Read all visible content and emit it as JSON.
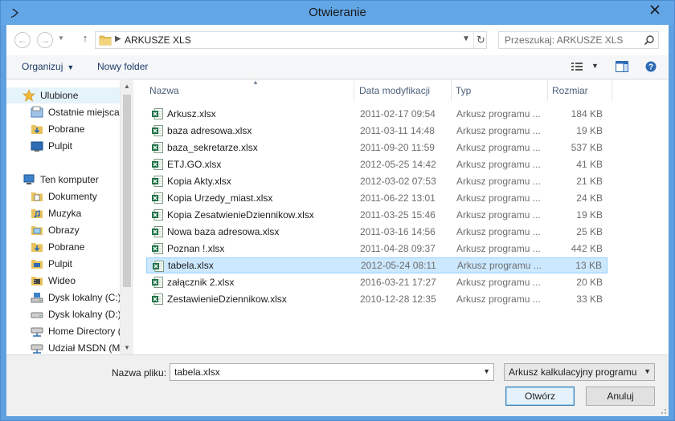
{
  "window": {
    "title": "Otwieranie",
    "accent": "#62a6e6"
  },
  "address": {
    "path": "ARKUSZE XLS",
    "search_placeholder": "Przeszukaj: ARKUSZE XLS"
  },
  "toolbar": {
    "organize_label": "Organizuj",
    "new_folder_label": "Nowy folder"
  },
  "nav": {
    "favorites": {
      "label": "Ulubione",
      "items": [
        "Ostatnie miejsca",
        "Pobrane",
        "Pulpit"
      ]
    },
    "computer": {
      "label": "Ten komputer",
      "items": [
        "Dokumenty",
        "Muzyka",
        "Obrazy",
        "Pobrane",
        "Pulpit",
        "Wideo",
        "Dysk lokalny (C:)",
        "Dysk lokalny (D:)",
        "Home Directory (",
        "Udział MSDN (M:"
      ]
    }
  },
  "columns": {
    "name": "Nazwa",
    "date": "Data modyfikacji",
    "type": "Typ",
    "size": "Rozmiar"
  },
  "files": [
    {
      "name": "Arkusz.xlsx",
      "date": "2011-02-17 09:54",
      "type": "Arkusz programu ...",
      "size": "184 KB"
    },
    {
      "name": "baza adresowa.xlsx",
      "date": "2011-03-11 14:48",
      "type": "Arkusz programu ...",
      "size": "19 KB"
    },
    {
      "name": "baza_sekretarze.xlsx",
      "date": "2011-09-20 11:59",
      "type": "Arkusz programu ...",
      "size": "537 KB"
    },
    {
      "name": "ETJ.GO.xlsx",
      "date": "2012-05-25 14:42",
      "type": "Arkusz programu ...",
      "size": "41 KB"
    },
    {
      "name": "Kopia Akty.xlsx",
      "date": "2012-03-02 07:53",
      "type": "Arkusz programu ...",
      "size": "21 KB"
    },
    {
      "name": "Kopia Urzedy_miast.xlsx",
      "date": "2011-06-22 13:01",
      "type": "Arkusz programu ...",
      "size": "24 KB"
    },
    {
      "name": "Kopia ZesatwienieDziennikow.xlsx",
      "date": "2011-03-25 15:46",
      "type": "Arkusz programu ...",
      "size": "19 KB"
    },
    {
      "name": "Nowa baza adresowa.xlsx",
      "date": "2011-03-16 14:56",
      "type": "Arkusz programu ...",
      "size": "25 KB"
    },
    {
      "name": "Poznan !.xlsx",
      "date": "2011-04-28 09:37",
      "type": "Arkusz programu ...",
      "size": "442 KB"
    },
    {
      "name": "tabela.xlsx",
      "date": "2012-05-24 08:11",
      "type": "Arkusz programu ...",
      "size": "13 KB",
      "selected": true
    },
    {
      "name": "załącznik 2.xlsx",
      "date": "2016-03-21 17:27",
      "type": "Arkusz programu ...",
      "size": "20 KB"
    },
    {
      "name": "ZestawienieDziennikow.xlsx",
      "date": "2010-12-28 12:35",
      "type": "Arkusz programu ...",
      "size": "33 KB"
    }
  ],
  "footer": {
    "filename_label": "Nazwa pliku:",
    "filename_value": "tabela.xlsx",
    "filetype_value": "Arkusz kalkulacyjny programu M",
    "open_label": "Otwórz",
    "cancel_label": "Anuluj"
  }
}
